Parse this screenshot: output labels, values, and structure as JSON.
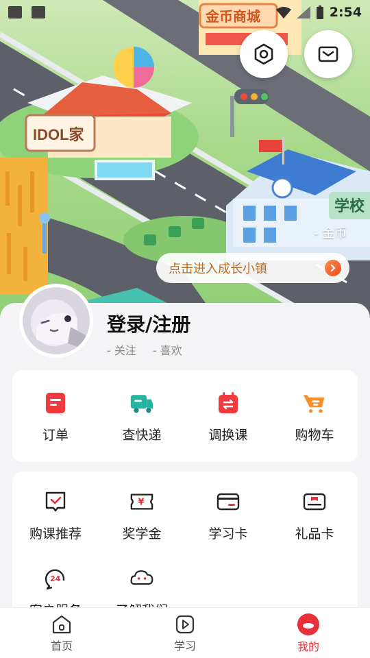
{
  "status_bar": {
    "time": "2:54"
  },
  "hero": {
    "sign_idol": "IDOL家",
    "sign_shop": "金币商城",
    "sign_school": "学校",
    "coin_label": "- 金币",
    "enter_town": "点击进入成长小镇"
  },
  "profile": {
    "title": "登录/注册",
    "follow": "- 关注",
    "likes": "- 喜欢"
  },
  "quick_actions": [
    {
      "label": "订单",
      "icon": "order-icon"
    },
    {
      "label": "查快递",
      "icon": "truck-icon"
    },
    {
      "label": "调换课",
      "icon": "swap-class-icon"
    },
    {
      "label": "购物车",
      "icon": "cart-icon"
    }
  ],
  "services": [
    {
      "label": "购课推荐",
      "icon": "recommend-icon"
    },
    {
      "label": "奖学金",
      "icon": "scholarship-icon"
    },
    {
      "label": "学习卡",
      "icon": "study-card-icon"
    },
    {
      "label": "礼品卡",
      "icon": "gift-card-icon"
    },
    {
      "label": "客户服务",
      "icon": "customer-service-icon"
    },
    {
      "label": "了解我们",
      "icon": "about-icon"
    }
  ],
  "bottom_nav": [
    {
      "label": "首页",
      "icon": "home-icon"
    },
    {
      "label": "学习",
      "icon": "play-icon"
    },
    {
      "label": "我的",
      "icon": "mine-icon"
    }
  ],
  "colors": {
    "accent": "#e8303a",
    "teal": "#25b3a2",
    "orange": "#f5902a"
  }
}
